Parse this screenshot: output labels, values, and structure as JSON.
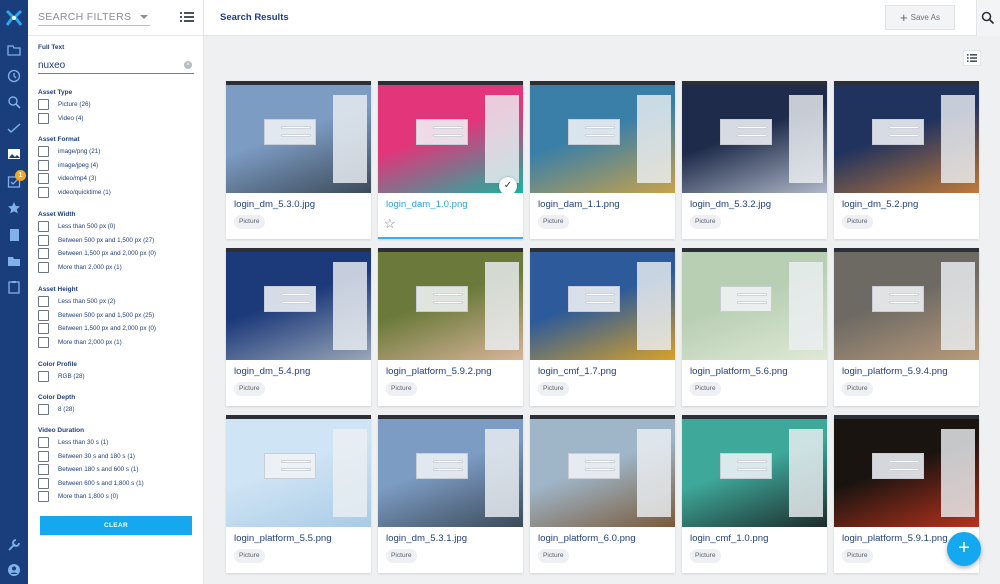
{
  "filters": {
    "placeholder": "SEARCH FILTERS",
    "full_text": {
      "title": "Full Text",
      "value": "nuxeo"
    },
    "groups": [
      {
        "title": "Asset Type",
        "options": [
          "Picture (26)",
          "Video (4)"
        ]
      },
      {
        "title": "Asset Format",
        "options": [
          "image/png (21)",
          "image/jpeg (4)",
          "video/mp4 (3)",
          "video/quicktime (1)"
        ]
      },
      {
        "title": "Asset Width",
        "options": [
          "Less than 500 px (0)",
          "Between 500 px and 1,500 px (27)",
          "Between 1,500 px and 2,000 px (0)",
          "More than 2,000 px (1)"
        ]
      },
      {
        "title": "Asset Height",
        "options": [
          "Less than 500 px (2)",
          "Between 500 px and 1,500 px (25)",
          "Between 1,500 px and 2,000 px (0)",
          "More than 2,000 px (1)"
        ]
      },
      {
        "title": "Color Profile",
        "options": [
          "RGB (28)"
        ]
      },
      {
        "title": "Color Depth",
        "options": [
          "8 (28)"
        ]
      },
      {
        "title": "Video Duration",
        "options": [
          "Less than 30 s (1)",
          "Between 30 s and 180 s (1)",
          "Between 180 s and 600 s (1)",
          "Between 600 s and 1,800 s (1)",
          "More than 1,800 s (0)"
        ]
      }
    ],
    "clear_label": "CLEAR"
  },
  "header": {
    "title": "Search Results",
    "save_as_label": "Save As"
  },
  "nav": {
    "tasks_badge": "1"
  },
  "results": [
    {
      "name": "login_dm_5.3.0.jpg",
      "type": "Picture",
      "colors": [
        "#7d9cc4",
        "#3b4a58"
      ]
    },
    {
      "name": "login_dam_1.0.png",
      "type": "",
      "colors": [
        "#e2357a",
        "#1bb3a0"
      ],
      "selected": true
    },
    {
      "name": "login_dam_1.1.png",
      "type": "Picture",
      "colors": [
        "#3a7fa8",
        "#c8a24a"
      ]
    },
    {
      "name": "login_dm_5.3.2.jpg",
      "type": "Picture",
      "colors": [
        "#1e2b4a",
        "#b1b9c8"
      ]
    },
    {
      "name": "login_dm_5.2.png",
      "type": "Picture",
      "colors": [
        "#20325e",
        "#c07a3a"
      ]
    },
    {
      "name": "login_dm_5.4.png",
      "type": "Picture",
      "colors": [
        "#1c3a7a",
        "#9aa6b8"
      ]
    },
    {
      "name": "login_platform_5.9.2.png",
      "type": "Picture",
      "colors": [
        "#6b7a3a",
        "#d8b49a"
      ]
    },
    {
      "name": "login_cmf_1.7.png",
      "type": "Picture",
      "colors": [
        "#2c5a9a",
        "#d8a12a"
      ]
    },
    {
      "name": "login_platform_5.6.png",
      "type": "Picture",
      "colors": [
        "#b9cfb4",
        "#dfe9d6"
      ]
    },
    {
      "name": "login_platform_5.9.4.png",
      "type": "Picture",
      "colors": [
        "#6d6a64",
        "#b89a7a"
      ]
    },
    {
      "name": "login_platform_5.5.png",
      "type": "Picture",
      "colors": [
        "#cfe4f4",
        "#a9cbe6"
      ]
    },
    {
      "name": "login_dm_5.3.1.jpg",
      "type": "Picture",
      "colors": [
        "#7d9cc4",
        "#3b4a58"
      ]
    },
    {
      "name": "login_platform_6.0.png",
      "type": "Picture",
      "colors": [
        "#9fb6c9",
        "#7a5a3a"
      ]
    },
    {
      "name": "login_cmf_1.0.png",
      "type": "Picture",
      "colors": [
        "#3ea89a",
        "#1d2b2a"
      ]
    },
    {
      "name": "login_platform_5.9.1.png",
      "type": "Picture",
      "colors": [
        "#1a1410",
        "#b8321e"
      ]
    }
  ]
}
